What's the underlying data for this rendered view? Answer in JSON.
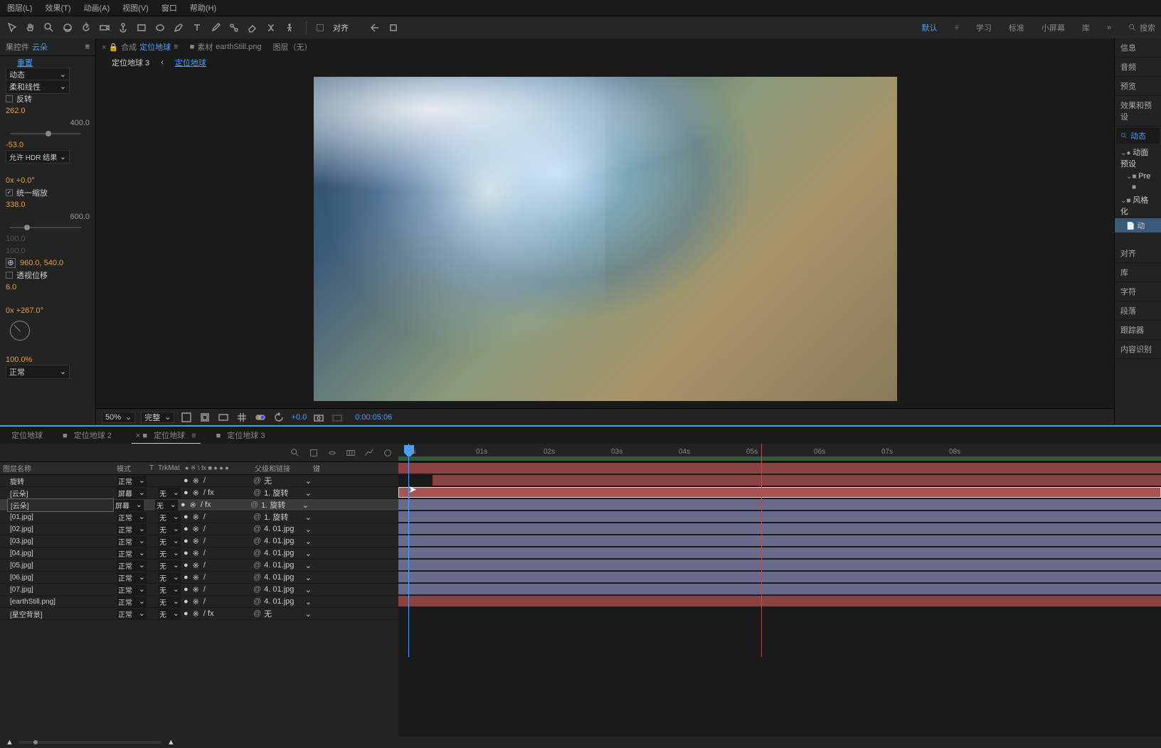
{
  "menu": {
    "items": [
      "图层(L)",
      "效果(T)",
      "动画(A)",
      "视图(V)",
      "窗口",
      "帮助(H)"
    ]
  },
  "toolbar_right": {
    "align": "对齐",
    "workspaces": [
      "默认",
      "学习",
      "标准",
      "小屏幕",
      "库"
    ],
    "search": "搜索"
  },
  "left_panel": {
    "tab_label": "果控件",
    "tab_name": "云朵",
    "reset": "重置",
    "anim_type": "动态",
    "line_type": "柔和线性",
    "invert": "反转",
    "val1": "262.0",
    "val1_max": "400.0",
    "val2": "-53.0",
    "hdr": "允许 HDR 结果",
    "rot1": "0x +0.0°",
    "uniform": "统一缩放",
    "scale": "338.0",
    "scale_max": "600.0",
    "pos": "960.0, 540.0",
    "persp": "透视位移",
    "val3": "6.0",
    "rot2": "0x +267.0°",
    "opacity": "100.0%",
    "blend": "正常"
  },
  "comp_tabs": {
    "tab1_pre": "合成",
    "tab1": "定位地球",
    "tab2_pre": "素材",
    "tab2": "earthStill.png",
    "tab3": "图层（无）"
  },
  "breadcrumb": {
    "prev": "定位地球 3",
    "cur": "定位地球"
  },
  "viewer_ctrl": {
    "zoom": "50%",
    "quality": "完整",
    "exposure": "+0.0",
    "timecode": "0:00:05:06"
  },
  "right_panel": {
    "items": [
      "信息",
      "音频",
      "预览",
      "效果和预设"
    ],
    "search": "动态",
    "tree": [
      "动面预设",
      "Pre",
      "风格化",
      "动"
    ],
    "divider_items": [
      "对齐",
      "库",
      "字符",
      "段落",
      "跟踪器",
      "内容识别"
    ]
  },
  "timeline_tabs": [
    "定位地球",
    "定位地球 2",
    "定位地球",
    "定位地球 3"
  ],
  "tl_header": {
    "name": "图层名称",
    "mode": "模式",
    "trk_pre": "T",
    "trk": "TrkMat",
    "parent": "父级和链接",
    "key": "键"
  },
  "layers": [
    {
      "name": "旋转",
      "mode": "正常",
      "trk": "",
      "sw": "/",
      "parent": "无",
      "bar": "red",
      "start": 0,
      "sel": false
    },
    {
      "name": "[云朵]",
      "mode": "屏幕",
      "trk": "无",
      "sw": "/ fx",
      "parent": "1. 旋转",
      "bar": "red",
      "start": 48,
      "sel": false
    },
    {
      "name": "[云朵]",
      "mode": "屏幕",
      "trk": "无",
      "sw": "/ fx",
      "parent": "1. 旋转",
      "bar": "red",
      "start": 0,
      "sel": true,
      "boxed": true
    },
    {
      "name": "[01.jpg]",
      "mode": "正常",
      "trk": "无",
      "sw": "/",
      "parent": "1. 旋转",
      "bar": "blue",
      "start": 0,
      "sel": false
    },
    {
      "name": "[02.jpg]",
      "mode": "正常",
      "trk": "无",
      "sw": "/",
      "parent": "4. 01.jpg",
      "bar": "blue",
      "start": 0,
      "sel": false
    },
    {
      "name": "[03.jpg]",
      "mode": "正常",
      "trk": "无",
      "sw": "/",
      "parent": "4. 01.jpg",
      "bar": "blue",
      "start": 0,
      "sel": false
    },
    {
      "name": "[04.jpg]",
      "mode": "正常",
      "trk": "无",
      "sw": "/",
      "parent": "4. 01.jpg",
      "bar": "blue",
      "start": 0,
      "sel": false
    },
    {
      "name": "[05.jpg]",
      "mode": "正常",
      "trk": "无",
      "sw": "/",
      "parent": "4. 01.jpg",
      "bar": "blue",
      "start": 0,
      "sel": false
    },
    {
      "name": "[06.jpg]",
      "mode": "正常",
      "trk": "无",
      "sw": "/",
      "parent": "4. 01.jpg",
      "bar": "blue",
      "start": 0,
      "sel": false
    },
    {
      "name": "[07.jpg]",
      "mode": "正常",
      "trk": "无",
      "sw": "/",
      "parent": "4. 01.jpg",
      "bar": "blue",
      "start": 0,
      "sel": false
    },
    {
      "name": "[earthStill.png]",
      "mode": "正常",
      "trk": "无",
      "sw": "/",
      "parent": "4. 01.jpg",
      "bar": "blue",
      "start": 0,
      "sel": false
    },
    {
      "name": "[星空背景]",
      "mode": "正常",
      "trk": "无",
      "sw": "/ fx",
      "parent": "无",
      "bar": "red",
      "start": 0,
      "sel": false
    }
  ],
  "ruler_ticks": [
    "0s",
    "01s",
    "02s",
    "03s",
    "04s",
    "05s",
    "06s",
    "07s",
    "08s"
  ],
  "switches_header": "● ※ \\ fx ■ ● ● ●"
}
